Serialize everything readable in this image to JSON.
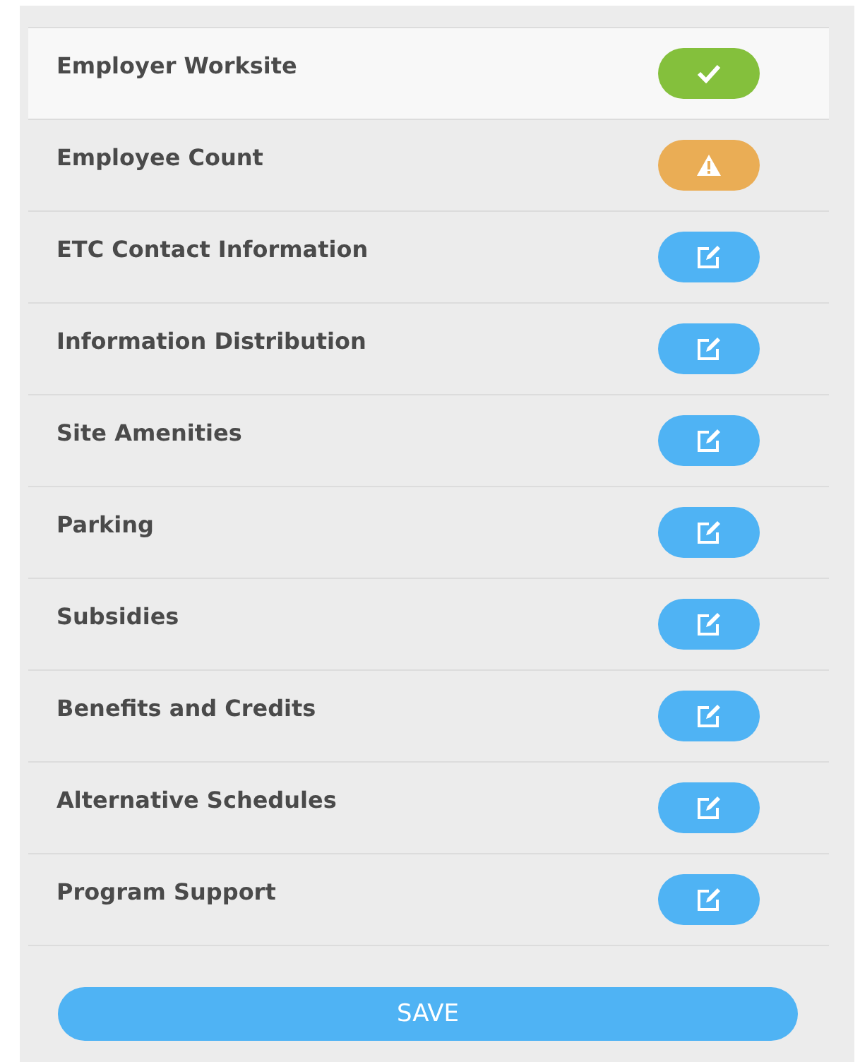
{
  "sections": [
    {
      "label": "Employer Worksite",
      "kind": "complete",
      "selected": true
    },
    {
      "label": "Employee Count",
      "kind": "warning",
      "selected": false
    },
    {
      "label": "ETC Contact Information",
      "kind": "edit",
      "selected": false
    },
    {
      "label": "Information Distribution",
      "kind": "edit",
      "selected": false
    },
    {
      "label": "Site Amenities",
      "kind": "edit",
      "selected": false
    },
    {
      "label": "Parking",
      "kind": "edit",
      "selected": false
    },
    {
      "label": "Subsidies",
      "kind": "edit",
      "selected": false
    },
    {
      "label": "Benefits and Credits",
      "kind": "edit",
      "selected": false
    },
    {
      "label": "Alternative Schedules",
      "kind": "edit",
      "selected": false
    },
    {
      "label": "Program Support",
      "kind": "edit",
      "selected": false
    }
  ],
  "save_button": "SAVE"
}
